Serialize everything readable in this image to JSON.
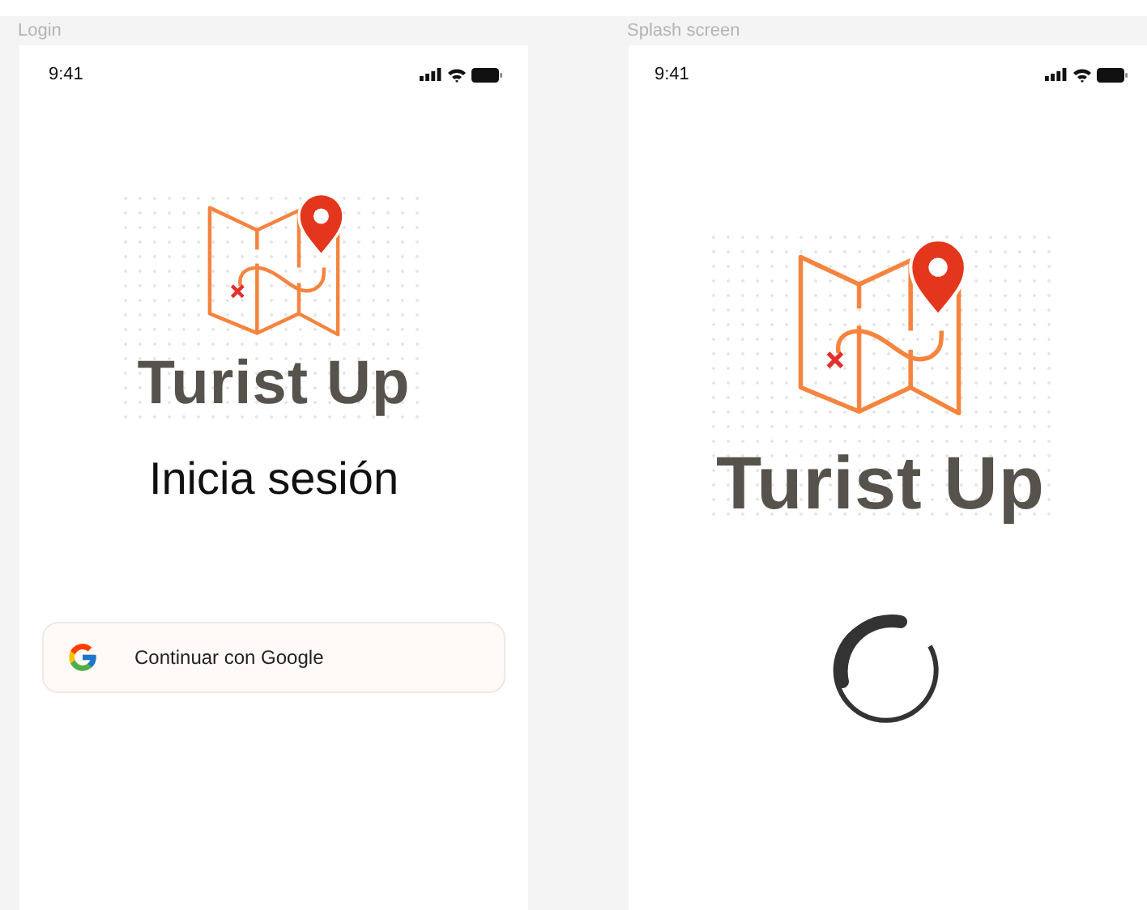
{
  "frames": [
    {
      "label": "Login",
      "kind": "login",
      "status_bar": {
        "time": "9:41"
      },
      "logo": {
        "name": "Turist Up"
      },
      "heading": "Inicia sesión",
      "google_button": {
        "label": "Continuar con Google"
      }
    },
    {
      "label": "Splash screen",
      "kind": "splash",
      "status_bar": {
        "time": "9:41"
      },
      "logo": {
        "name": "Turist Up"
      }
    }
  ]
}
